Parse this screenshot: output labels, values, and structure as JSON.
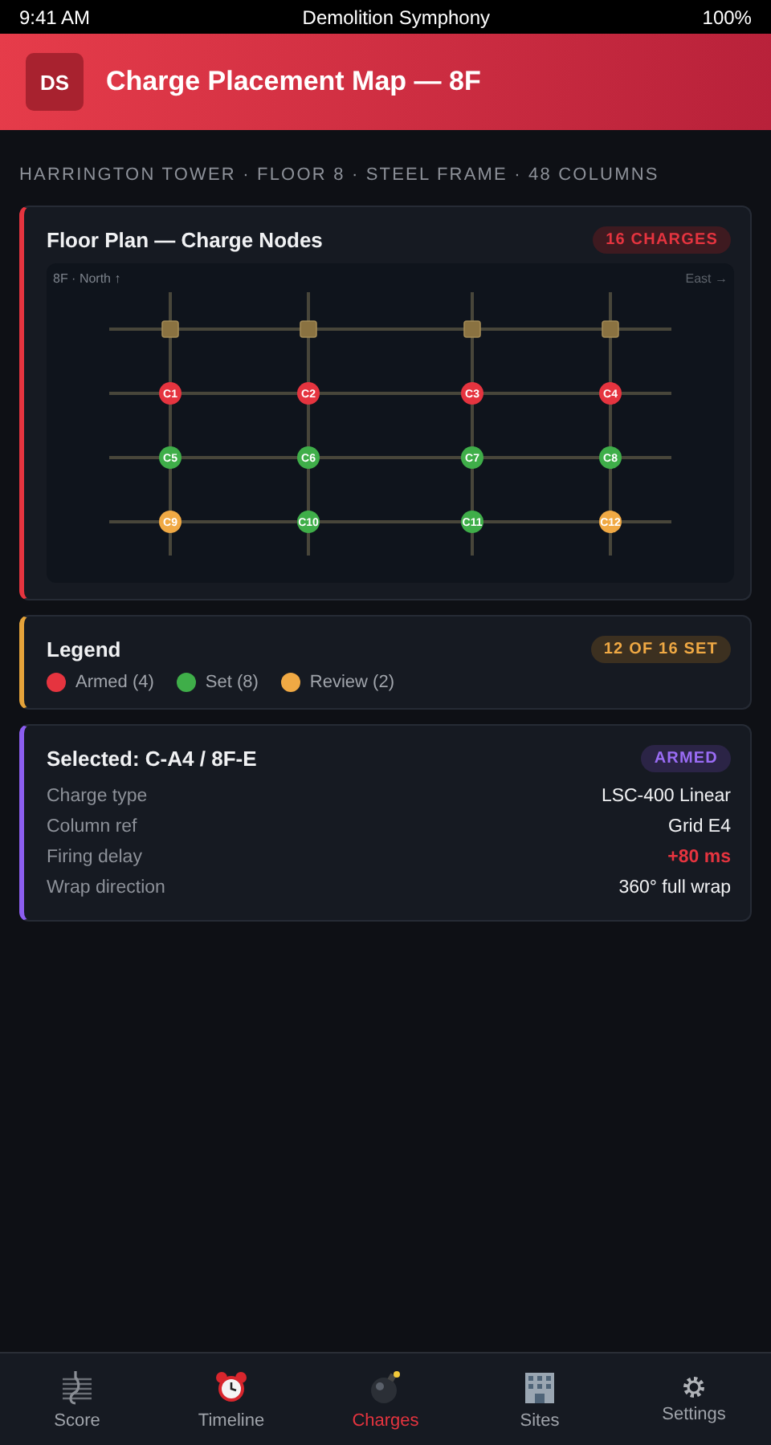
{
  "status_bar": {
    "time": "9:41 AM",
    "title": "Demolition Symphony",
    "battery": "100%"
  },
  "header": {
    "logo": "DS",
    "title": "Charge Placement Map — 8F"
  },
  "subtitle": "HARRINGTON TOWER · FLOOR 8 · STEEL FRAME · 48 COLUMNS",
  "floor_plan": {
    "title": "Floor Plan — Charge Nodes",
    "badge": "16 CHARGES",
    "north_label": "8F · North ↑",
    "east_label": "East →",
    "nodes": [
      {
        "label": "C1",
        "color": "#e5343f"
      },
      {
        "label": "C2",
        "color": "#e5343f"
      },
      {
        "label": "C3",
        "color": "#e5343f"
      },
      {
        "label": "C4",
        "color": "#e5343f"
      },
      {
        "label": "C5",
        "color": "#3fae49"
      },
      {
        "label": "C6",
        "color": "#3fae49"
      },
      {
        "label": "C7",
        "color": "#3fae49"
      },
      {
        "label": "C8",
        "color": "#3fae49"
      },
      {
        "label": "C9",
        "color": "#f0a944"
      },
      {
        "label": "C10",
        "color": "#3fae49"
      },
      {
        "label": "C11",
        "color": "#3fae49"
      },
      {
        "label": "C12",
        "color": "#f0a944"
      }
    ]
  },
  "legend": {
    "title": "Legend",
    "badge": "12 OF 16 SET",
    "items": [
      {
        "label": "Armed (4)",
        "color": "#e5343f"
      },
      {
        "label": "Set (8)",
        "color": "#3fae49"
      },
      {
        "label": "Review (2)",
        "color": "#f0a944"
      }
    ]
  },
  "selected": {
    "title": "Selected: C-A4 / 8F-E",
    "badge": "ARMED",
    "rows": [
      {
        "label": "Charge type",
        "value": "LSC-400 Linear",
        "kind": "plain"
      },
      {
        "label": "Column ref",
        "value": "Grid E4",
        "kind": "plain"
      },
      {
        "label": "Firing delay",
        "value": "+80 ms",
        "kind": "alert"
      },
      {
        "label": "Wrap direction",
        "value": "360° full wrap",
        "kind": "plain"
      }
    ]
  },
  "nav": [
    {
      "label": "Score",
      "kind": "score",
      "selected": false
    },
    {
      "label": "Timeline",
      "kind": "clock",
      "selected": false
    },
    {
      "label": "Charges",
      "kind": "bomb",
      "selected": true
    },
    {
      "label": "Sites",
      "kind": "building",
      "selected": false
    },
    {
      "label": "Settings",
      "kind": "gear",
      "selected": false
    }
  ]
}
